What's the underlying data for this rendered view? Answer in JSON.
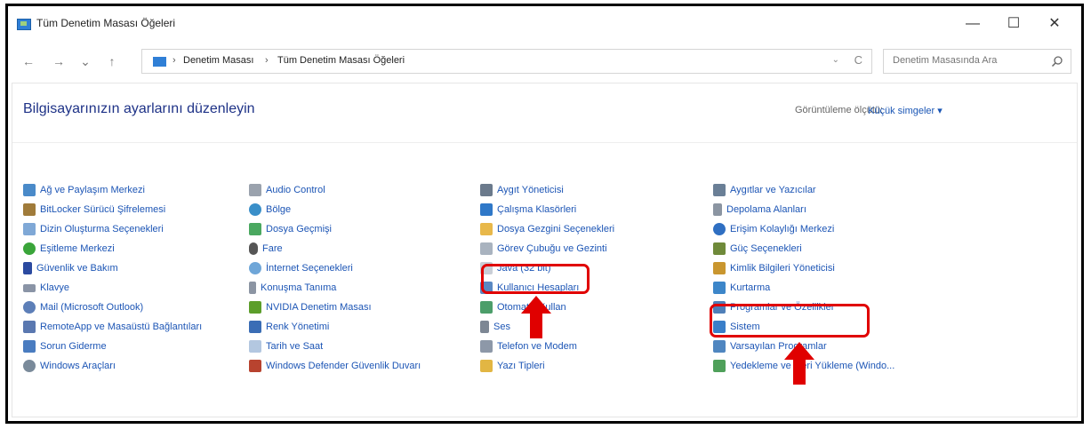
{
  "window": {
    "title": "Tüm Denetim Masası Öğeleri",
    "minimize": "—",
    "maximize": "☐",
    "close": "✕"
  },
  "nav": {
    "back": "←",
    "forward": "→",
    "recent": "⌄",
    "up": "↑"
  },
  "address": {
    "crumbs": [
      "Denetim Masası",
      "Tüm Denetim Masası Öğeleri"
    ],
    "separator": "›",
    "dropdown": "⌄",
    "refresh": "C"
  },
  "search": {
    "placeholder": "Denetim Masasında Ara"
  },
  "content": {
    "heading": "Bilgisayarınızın ayarlarını düzenleyin",
    "view_by_label": "Görüntüleme ölçütü:",
    "view_by_value": "Küçük simgeler ▾"
  },
  "items": {
    "col1": [
      "Ağ ve Paylaşım Merkezi",
      "BitLocker Sürücü Şifrelemesi",
      "Dizin Oluşturma Seçenekleri",
      "Eşitleme Merkezi",
      "Güvenlik ve Bakım",
      "Klavye",
      "Mail (Microsoft Outlook)",
      "RemoteApp ve Masaüstü Bağlantıları",
      "Sorun Giderme",
      "Windows Araçları"
    ],
    "col2": [
      "Audio Control",
      "Bölge",
      "Dosya Geçmişi",
      "Fare",
      "İnternet Seçenekleri",
      "Konuşma Tanıma",
      "NVIDIA Denetim Masası",
      "Renk Yönetimi",
      "Tarih ve Saat",
      "Windows Defender Güvenlik Duvarı"
    ],
    "col3": [
      "Aygıt Yöneticisi",
      "Çalışma Klasörleri",
      "Dosya Gezgini Seçenekleri",
      "Görev Çubuğu ve Gezinti",
      "Java (32 bit)",
      "Kullanıcı Hesapları",
      "Otomatik Kullan",
      "Ses",
      "Telefon ve Modem",
      "Yazı Tipleri"
    ],
    "col4": [
      "Aygıtlar ve Yazıcılar",
      "Depolama Alanları",
      "Erişim Kolaylığı Merkezi",
      "Güç Seçenekleri",
      "Kimlik Bilgileri Yöneticisi",
      "Kurtarma",
      "Programlar ve Özellikler",
      "Sistem",
      "Varsayılan Programlar",
      "Yedekleme ve Geri Yükleme (Windo..."
    ]
  },
  "colors": {
    "link": "#1c55b5",
    "heading": "#1e3287",
    "highlight": "#e00000"
  }
}
